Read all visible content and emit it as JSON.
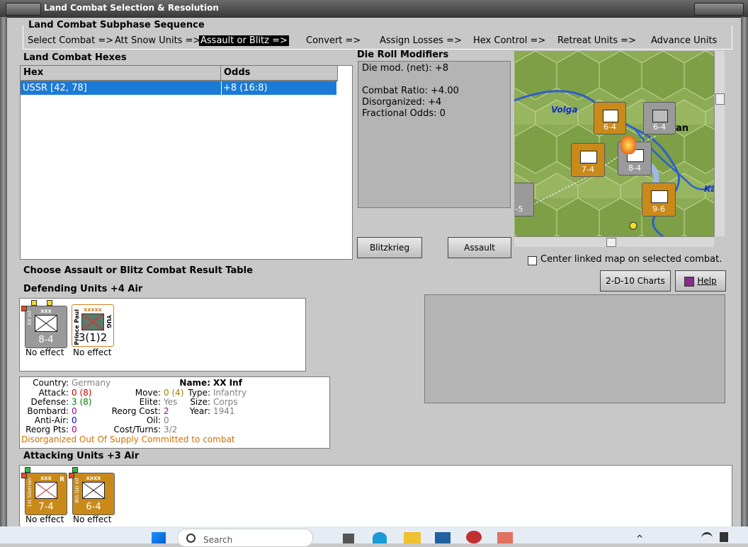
{
  "window": {
    "title": "Land Combat Selection & Resolution"
  },
  "sequence": {
    "heading": "Land Combat Subphase Sequence",
    "steps": [
      "Select Combat =>",
      "Att Snow Units =>",
      "Assault or Blitz =>",
      "Convert =>",
      "Assign Losses =>",
      "Hex Control =>",
      "Retreat Units =>",
      "Advance Units"
    ]
  },
  "hexes": {
    "heading": "Land Combat Hexes",
    "columns": [
      "Hex",
      "Odds"
    ],
    "rows": [
      {
        "hex": "USSR [42, 78]",
        "odds": "+8 (16:8)"
      }
    ]
  },
  "modifiers": {
    "heading": "Die Roll Modifiers",
    "line1": "Die mod. (net): +8",
    "line2": "Combat Ratio: +4.00",
    "line3": "Disorganized: +4",
    "line4": "Fractional Odds: 0"
  },
  "buttons": {
    "blitzkrieg": "Blitzkrieg",
    "assault": "Assault",
    "charts": "2-D-10 Charts",
    "help": "Help"
  },
  "center_map_label": "Center linked map on selected combat.",
  "map": {
    "river_label_1": "Volga",
    "city_partial": "an",
    "river_label_2": "Ka"
  },
  "choose_label": "Choose Assault or Blitz Combat Result Table",
  "defending": {
    "heading": "Defending Units +4 Air",
    "units": [
      {
        "size": "xxx",
        "name": "XX Inf",
        "strength": "8-4",
        "effect": "No effect"
      },
      {
        "size": "xxxxx",
        "name": "Prince Paul",
        "nation": "YUG",
        "strength": "3(1)2",
        "effect": "No effect"
      }
    ]
  },
  "info": {
    "country_label": "Country:",
    "country": "Germany",
    "attack_label": "Attack:",
    "attack": "0",
    "attack_paren": "(8)",
    "defense_label": "Defense:",
    "defense": "3",
    "defense_paren": "(8)",
    "bombard_label": "Bombard:",
    "bombard": "0",
    "antiair_label": "Anti-Air:",
    "antiair": "0",
    "reorgpts_label": "Reorg Pts:",
    "reorgpts": "0",
    "move_label": "Move:",
    "move": "0",
    "move_paren": "(4)",
    "elite_label": "Elite:",
    "elite": "Yes",
    "reorgcost_label": "Reorg Cost:",
    "reorgcost": "2",
    "oil_label": "Oil:",
    "oil": "0",
    "costturns_label": "Cost/Turns:",
    "costturns": "3/2",
    "name_label": "Name:",
    "name": "XX Inf",
    "type_label": "Type:",
    "type": "Infantry",
    "size_label": "Size:",
    "size": "Corps",
    "year_label": "Year:",
    "year": "1941",
    "status": "Disorganized Out Of Supply Committed to combat"
  },
  "attacking": {
    "heading": "Attacking Units +3 Air",
    "units": [
      {
        "size": "xxx",
        "name": "1st Siberian",
        "strength": "7-4",
        "effect": "No effect"
      },
      {
        "size": "xxxx",
        "name": "8th GD Inf",
        "strength": "6-4",
        "effect": "No effect"
      }
    ]
  },
  "taskbar": {
    "search_placeholder": "Search"
  },
  "colors": {
    "selection": "#1a7ad6",
    "counter_soviet": "#c98a1a",
    "counter_axis": "#9a9a9a",
    "status_orange": "#d07000",
    "attack_red": "#d00000",
    "defense_green": "#008000",
    "blue_value": "#0000cc",
    "purple_value": "#a000a0"
  }
}
